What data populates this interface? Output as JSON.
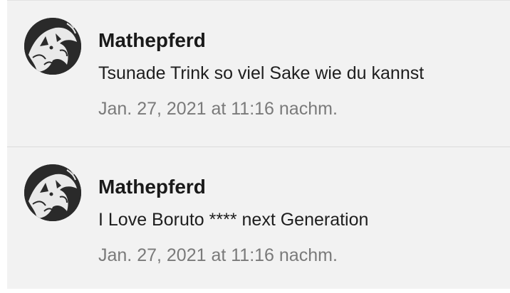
{
  "comments": [
    {
      "author": "Mathepferd",
      "text": "Tsunade Trink so viel Sake wie du kannst",
      "timestamp": "Jan. 27, 2021 at 11:16 nachm.",
      "avatar_icon": "wolf-avatar-icon"
    },
    {
      "author": "Mathepferd",
      "text": "I Love Boruto **** next Generation",
      "timestamp": "Jan. 27, 2021 at 11:16 nachm.",
      "avatar_icon": "wolf-avatar-icon"
    }
  ]
}
